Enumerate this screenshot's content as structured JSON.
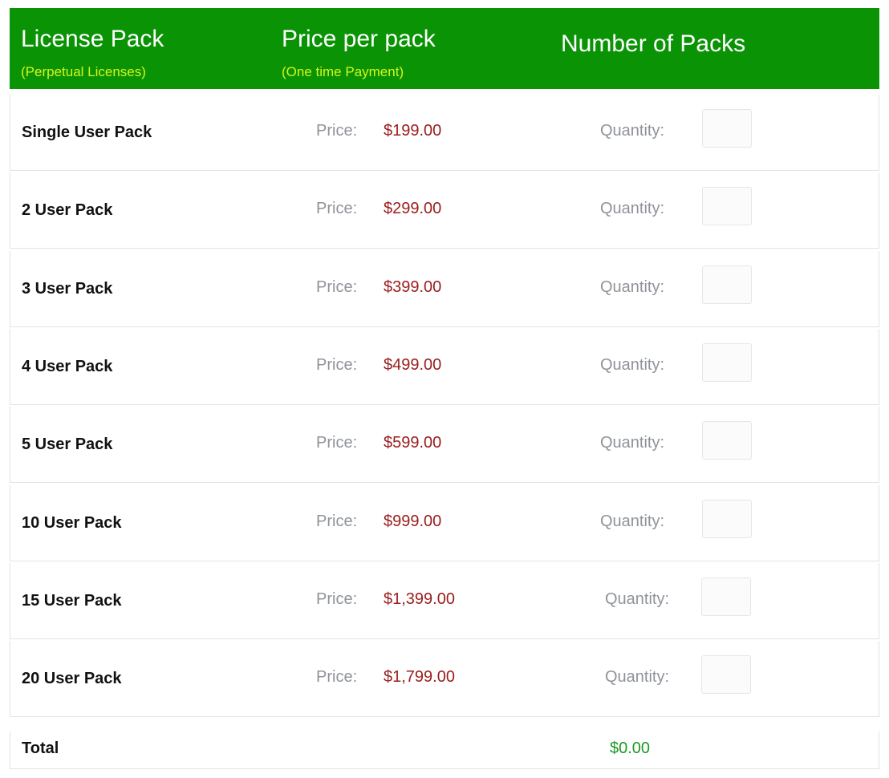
{
  "header": {
    "col1": {
      "title": "License Pack",
      "subtitle": "(Perpetual Licenses)"
    },
    "col2": {
      "title": "Price per pack",
      "subtitle": "(One time Payment)"
    },
    "col3": {
      "title": "Number of Packs"
    }
  },
  "labels": {
    "price": "Price:",
    "quantity": "Quantity:"
  },
  "rows": [
    {
      "pack": "Single User Pack",
      "price": "$199.00",
      "quantity": ""
    },
    {
      "pack": "2 User Pack",
      "price": "$299.00",
      "quantity": ""
    },
    {
      "pack": "3 User Pack",
      "price": "$399.00",
      "quantity": ""
    },
    {
      "pack": "4 User Pack",
      "price": "$499.00",
      "quantity": ""
    },
    {
      "pack": "5 User Pack",
      "price": "$599.00",
      "quantity": ""
    },
    {
      "pack": "10 User Pack",
      "price": "$999.00",
      "quantity": ""
    },
    {
      "pack": "15 User Pack",
      "price": "$1,399.00",
      "quantity": ""
    },
    {
      "pack": "20 User Pack",
      "price": "$1,799.00",
      "quantity": ""
    }
  ],
  "total": {
    "label": "Total",
    "value": "$0.00"
  },
  "colors": {
    "header_bg": "#0a9405",
    "subtitle": "#d4f51a",
    "price": "#9b1c1c",
    "total": "#1c9a24"
  }
}
